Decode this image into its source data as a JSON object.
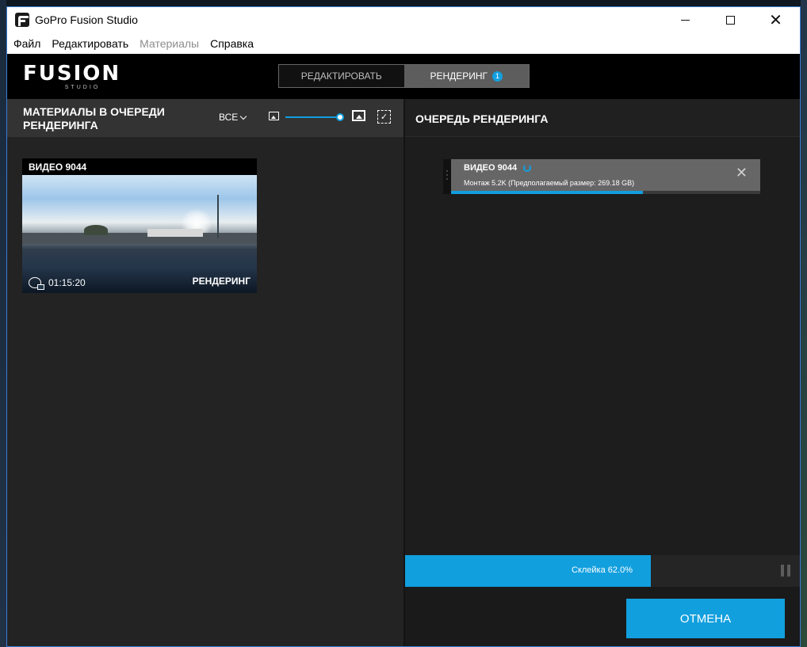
{
  "window": {
    "title": "GoPro Fusion Studio",
    "close_glyph": "✕"
  },
  "menu": [
    {
      "label": "Файл",
      "disabled": false
    },
    {
      "label": "Редактировать",
      "disabled": false
    },
    {
      "label": "Материалы",
      "disabled": true
    },
    {
      "label": "Справка",
      "disabled": false
    }
  ],
  "header": {
    "logo_main": "FUSION",
    "logo_sub": "STUDIO",
    "tabs": [
      {
        "label": "РЕДАКТИРОВАТЬ",
        "active": false
      },
      {
        "label": "РЕНДЕРИНГ",
        "active": true,
        "badge": "1"
      }
    ]
  },
  "left_panel": {
    "title": "МАТЕРИАЛЫ В ОЧЕРЕДИ РЕНДЕРИНГА",
    "filter_label": "ВСЕ",
    "thumbnail_size_level": 0.9,
    "select_icon_glyph": "✓",
    "media": [
      {
        "title": "ВИДЕО 9044",
        "duration": "01:15:20",
        "status": "РЕНДЕРИНГ"
      }
    ]
  },
  "right_panel": {
    "title": "ОЧЕРЕДЬ РЕНДЕРИНГА",
    "queue": [
      {
        "title": "ВИДЕО 9044",
        "subtitle": "Монтаж 5.2K  (Предполагаемый размер: 269.18 GB)",
        "progress": 0.62,
        "close_glyph": "✕"
      }
    ],
    "stitch_label": "Склейка 62.0%",
    "stitch_progress": 0.62,
    "cancel_label": "ОТМЕНА"
  },
  "colors": {
    "accent": "#129fde"
  }
}
